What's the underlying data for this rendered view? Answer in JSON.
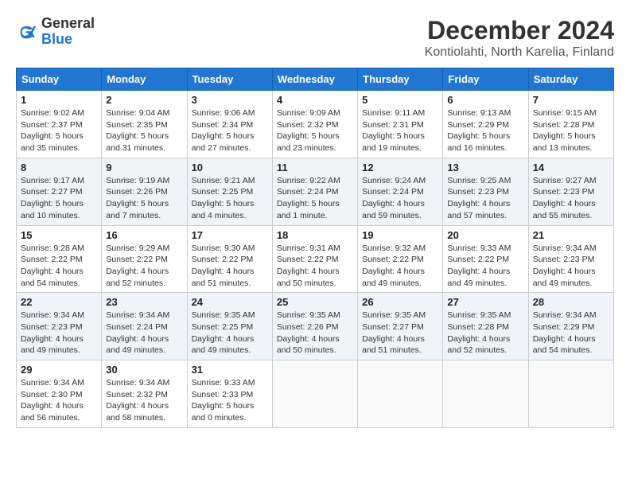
{
  "header": {
    "logo": {
      "general": "General",
      "blue": "Blue"
    },
    "title": "December 2024",
    "subtitle": "Kontiolahti, North Karelia, Finland"
  },
  "calendar": {
    "weekdays": [
      "Sunday",
      "Monday",
      "Tuesday",
      "Wednesday",
      "Thursday",
      "Friday",
      "Saturday"
    ],
    "weeks": [
      [
        {
          "day": "1",
          "sunrise": "9:02 AM",
          "sunset": "2:37 PM",
          "daylight": "5 hours and 35 minutes."
        },
        {
          "day": "2",
          "sunrise": "9:04 AM",
          "sunset": "2:35 PM",
          "daylight": "5 hours and 31 minutes."
        },
        {
          "day": "3",
          "sunrise": "9:06 AM",
          "sunset": "2:34 PM",
          "daylight": "5 hours and 27 minutes."
        },
        {
          "day": "4",
          "sunrise": "9:09 AM",
          "sunset": "2:32 PM",
          "daylight": "5 hours and 23 minutes."
        },
        {
          "day": "5",
          "sunrise": "9:11 AM",
          "sunset": "2:31 PM",
          "daylight": "5 hours and 19 minutes."
        },
        {
          "day": "6",
          "sunrise": "9:13 AM",
          "sunset": "2:29 PM",
          "daylight": "5 hours and 16 minutes."
        },
        {
          "day": "7",
          "sunrise": "9:15 AM",
          "sunset": "2:28 PM",
          "daylight": "5 hours and 13 minutes."
        }
      ],
      [
        {
          "day": "8",
          "sunrise": "9:17 AM",
          "sunset": "2:27 PM",
          "daylight": "5 hours and 10 minutes."
        },
        {
          "day": "9",
          "sunrise": "9:19 AM",
          "sunset": "2:26 PM",
          "daylight": "5 hours and 7 minutes."
        },
        {
          "day": "10",
          "sunrise": "9:21 AM",
          "sunset": "2:25 PM",
          "daylight": "5 hours and 4 minutes."
        },
        {
          "day": "11",
          "sunrise": "9:22 AM",
          "sunset": "2:24 PM",
          "daylight": "5 hours and 1 minute."
        },
        {
          "day": "12",
          "sunrise": "9:24 AM",
          "sunset": "2:24 PM",
          "daylight": "4 hours and 59 minutes."
        },
        {
          "day": "13",
          "sunrise": "9:25 AM",
          "sunset": "2:23 PM",
          "daylight": "4 hours and 57 minutes."
        },
        {
          "day": "14",
          "sunrise": "9:27 AM",
          "sunset": "2:23 PM",
          "daylight": "4 hours and 55 minutes."
        }
      ],
      [
        {
          "day": "15",
          "sunrise": "9:28 AM",
          "sunset": "2:22 PM",
          "daylight": "4 hours and 54 minutes."
        },
        {
          "day": "16",
          "sunrise": "9:29 AM",
          "sunset": "2:22 PM",
          "daylight": "4 hours and 52 minutes."
        },
        {
          "day": "17",
          "sunrise": "9:30 AM",
          "sunset": "2:22 PM",
          "daylight": "4 hours and 51 minutes."
        },
        {
          "day": "18",
          "sunrise": "9:31 AM",
          "sunset": "2:22 PM",
          "daylight": "4 hours and 50 minutes."
        },
        {
          "day": "19",
          "sunrise": "9:32 AM",
          "sunset": "2:22 PM",
          "daylight": "4 hours and 49 minutes."
        },
        {
          "day": "20",
          "sunrise": "9:33 AM",
          "sunset": "2:22 PM",
          "daylight": "4 hours and 49 minutes."
        },
        {
          "day": "21",
          "sunrise": "9:34 AM",
          "sunset": "2:23 PM",
          "daylight": "4 hours and 49 minutes."
        }
      ],
      [
        {
          "day": "22",
          "sunrise": "9:34 AM",
          "sunset": "2:23 PM",
          "daylight": "4 hours and 49 minutes."
        },
        {
          "day": "23",
          "sunrise": "9:34 AM",
          "sunset": "2:24 PM",
          "daylight": "4 hours and 49 minutes."
        },
        {
          "day": "24",
          "sunrise": "9:35 AM",
          "sunset": "2:25 PM",
          "daylight": "4 hours and 49 minutes."
        },
        {
          "day": "25",
          "sunrise": "9:35 AM",
          "sunset": "2:26 PM",
          "daylight": "4 hours and 50 minutes."
        },
        {
          "day": "26",
          "sunrise": "9:35 AM",
          "sunset": "2:27 PM",
          "daylight": "4 hours and 51 minutes."
        },
        {
          "day": "27",
          "sunrise": "9:35 AM",
          "sunset": "2:28 PM",
          "daylight": "4 hours and 52 minutes."
        },
        {
          "day": "28",
          "sunrise": "9:34 AM",
          "sunset": "2:29 PM",
          "daylight": "4 hours and 54 minutes."
        }
      ],
      [
        {
          "day": "29",
          "sunrise": "9:34 AM",
          "sunset": "2:30 PM",
          "daylight": "4 hours and 56 minutes."
        },
        {
          "day": "30",
          "sunrise": "9:34 AM",
          "sunset": "2:32 PM",
          "daylight": "4 hours and 58 minutes."
        },
        {
          "day": "31",
          "sunrise": "9:33 AM",
          "sunset": "2:33 PM",
          "daylight": "5 hours and 0 minutes."
        },
        null,
        null,
        null,
        null
      ]
    ]
  }
}
